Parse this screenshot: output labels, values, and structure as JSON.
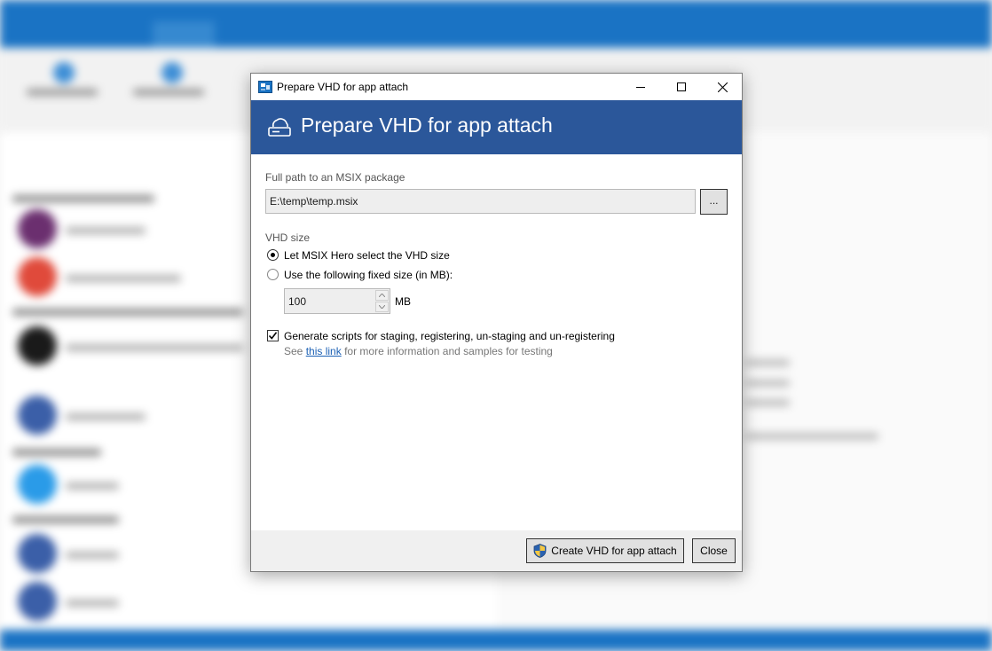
{
  "window": {
    "title": "Prepare VHD for app attach"
  },
  "header": {
    "title": "Prepare VHD for app attach",
    "icon": "cloud-drive-icon"
  },
  "package": {
    "label": "Full path to an MSIX package",
    "value": "E:\\temp\\temp.msix",
    "browse_label": "..."
  },
  "vhd_size": {
    "label": "VHD size",
    "options": [
      {
        "label": "Let MSIX Hero select the VHD size",
        "selected": true
      },
      {
        "label": "Use the following fixed size (in MB):",
        "selected": false
      }
    ],
    "fixed_value": "100",
    "unit": "MB"
  },
  "scripts": {
    "label": "Generate scripts for staging, registering, un-staging and un-registering",
    "checked": true,
    "hint_prefix": "See",
    "hint_link": "this link",
    "hint_suffix": "for more information and samples for testing"
  },
  "footer": {
    "create_label": "Create VHD for app attach",
    "close_label": "Close"
  },
  "colors": {
    "header_bg": "#2b579a",
    "app_accent": "#1a73c4",
    "link": "#1a5fb4"
  }
}
